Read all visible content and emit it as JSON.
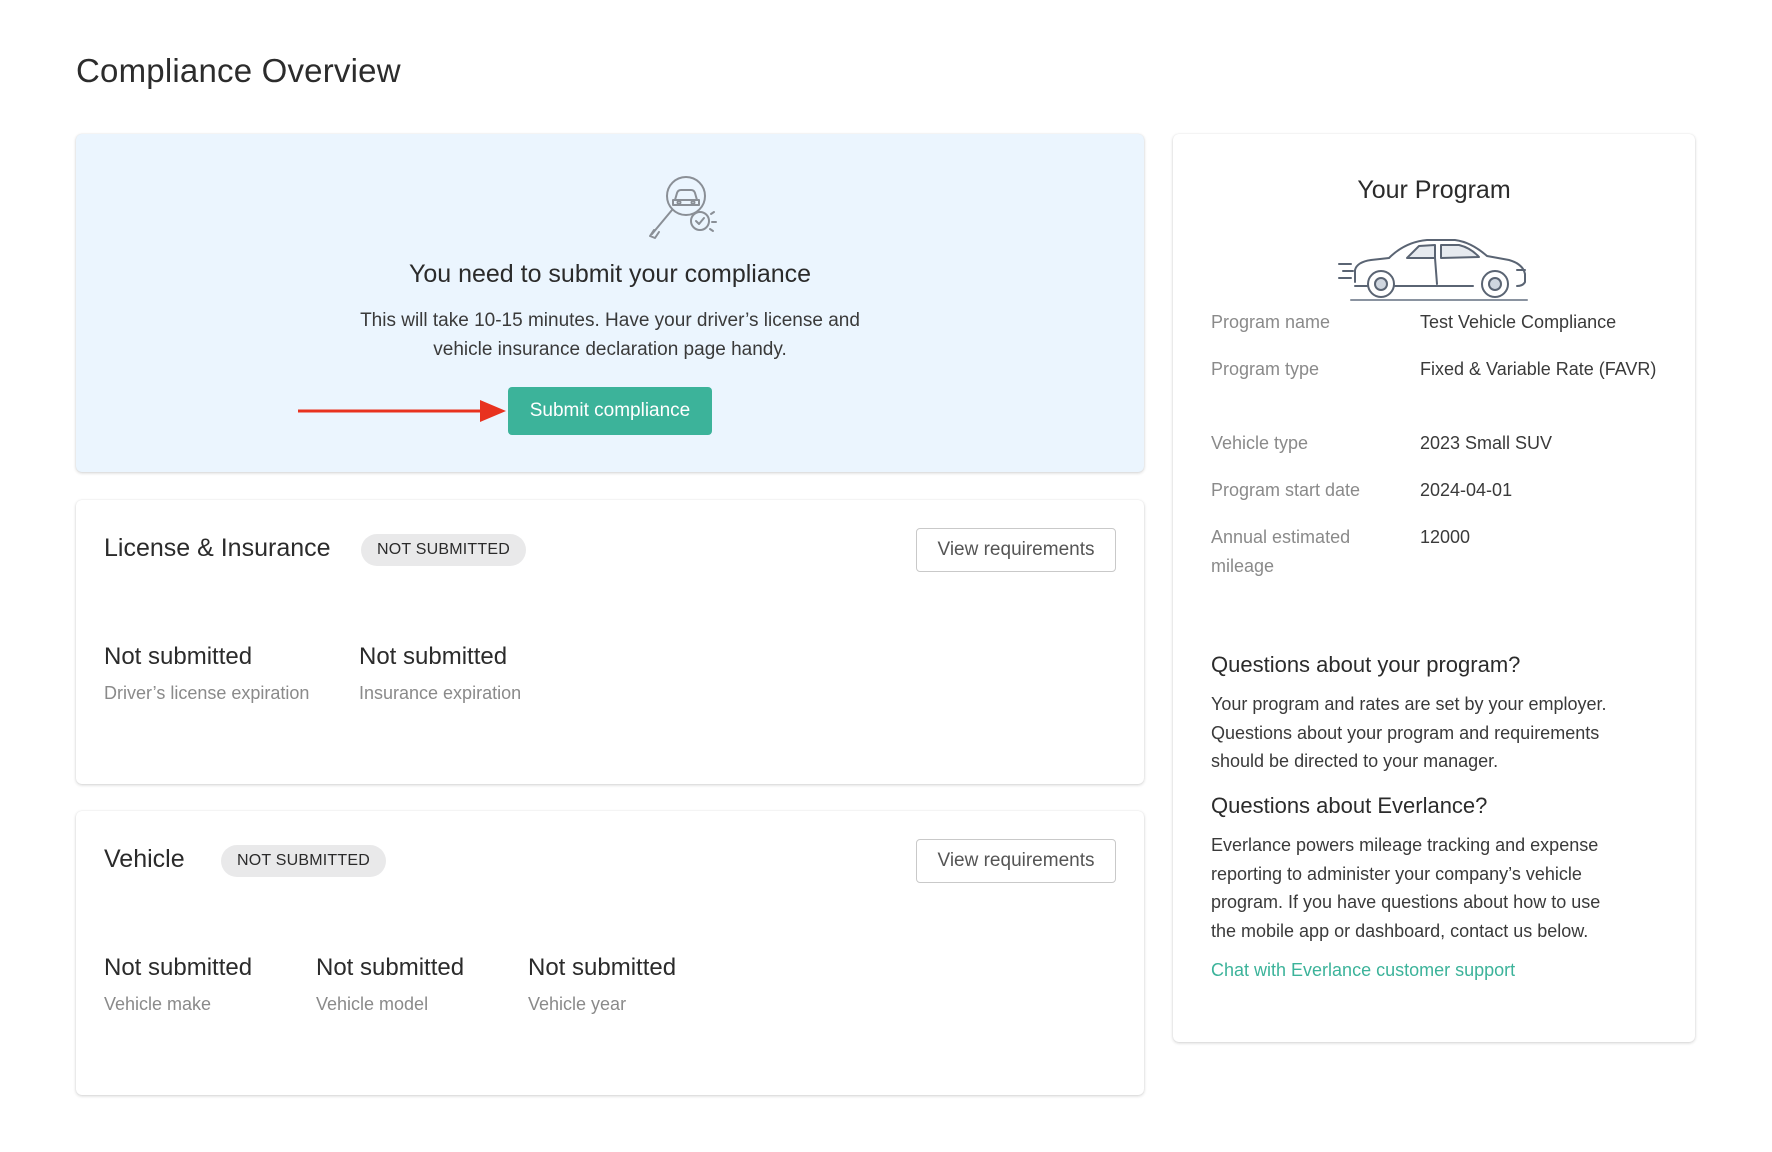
{
  "page": {
    "title": "Compliance Overview"
  },
  "hero": {
    "title": "You need to submit your compliance",
    "description_lines": [
      "This will take 10-15 minutes. Have your driver’s license and",
      "vehicle insurance declaration page handy."
    ],
    "button_label": "Submit compliance",
    "icon": "magnifier-car-check-icon"
  },
  "license_section": {
    "title": "License & Insurance",
    "badge": "NOT SUBMITTED",
    "button_label": "View requirements",
    "fields": [
      {
        "value": "Not submitted",
        "label": "Driver’s license expiration"
      },
      {
        "value": "Not submitted",
        "label": "Insurance expiration"
      }
    ]
  },
  "vehicle_section": {
    "title": "Vehicle",
    "badge": "NOT SUBMITTED",
    "button_label": "View requirements",
    "fields": [
      {
        "value": "Not submitted",
        "label": "Vehicle make"
      },
      {
        "value": "Not submitted",
        "label": "Vehicle model"
      },
      {
        "value": "Not submitted",
        "label": "Vehicle year"
      }
    ]
  },
  "program": {
    "title": "Your Program",
    "icon": "car-icon",
    "details": [
      {
        "label": "Program name",
        "value": "Test Vehicle Compliance"
      },
      {
        "label": "Program type",
        "value": "Fixed & Variable Rate (FAVR)"
      },
      {
        "label": "Vehicle type",
        "value": "2023 Small SUV"
      },
      {
        "label": "Program start date",
        "value": "2024-04-01"
      },
      {
        "label": "Annual estimated mileage",
        "value": "12000"
      }
    ],
    "questions_program": {
      "title": "Questions about your program?",
      "lines": [
        "Your program and rates are set by your employer.",
        "Questions about your program and requirements",
        "should be directed to your manager."
      ]
    },
    "questions_everlance": {
      "title": "Questions about Everlance?",
      "lines": [
        "Everlance powers mileage tracking and expense",
        "reporting to administer your company’s vehicle",
        "program. If you have questions about how to use",
        "the mobile app or dashboard, contact us below."
      ]
    },
    "support_link": "Chat with Everlance customer support"
  },
  "colors": {
    "accent": "#3cb39a",
    "hero_background": "#ebf5fe",
    "badge_background": "#e9e9ea",
    "annotation_arrow": "#e8321f"
  }
}
